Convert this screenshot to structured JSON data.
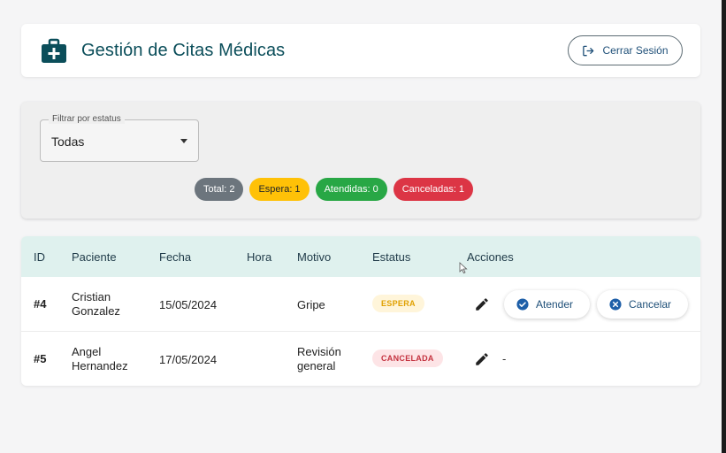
{
  "header": {
    "title": "Gestión de Citas Médicas",
    "logout_label": "Cerrar Sesión"
  },
  "filter": {
    "legend": "Filtrar por estatus",
    "value": "Todas"
  },
  "chips": {
    "total": "Total: 2",
    "espera": "Espera: 1",
    "atendidas": "Atendidas: 0",
    "canceladas": "Canceladas: 1"
  },
  "table": {
    "headers": [
      "ID",
      "Paciente",
      "Fecha",
      "Hora",
      "Motivo",
      "Estatus",
      "Acciones"
    ],
    "rows": [
      {
        "id": "#4",
        "paciente_line1": "Cristian",
        "paciente_line2": "Gonzalez",
        "fecha": "15/05/2024",
        "hora": "",
        "motivo_line1": "Gripe",
        "motivo_line2": "",
        "estatus": "ESPERA",
        "atender_label": "Atender",
        "cancelar_label": "Cancelar"
      },
      {
        "id": "#5",
        "paciente_line1": "Angel",
        "paciente_line2": "Hernandez",
        "fecha": "17/05/2024",
        "hora": "",
        "motivo_line1": "Revisión",
        "motivo_line2": "general",
        "estatus": "CANCELADA",
        "acciones_placeholder": "-"
      }
    ]
  },
  "colors": {
    "brand": "#0b4e5a",
    "header_row": "#dff1ee",
    "total": "#6c757d",
    "espera": "#ffc107",
    "atendidas": "#28a745",
    "canceladas": "#dc3545",
    "action_blue": "#1e5fa8"
  },
  "icons": {
    "brand": "medical-kit-icon",
    "logout": "logout-icon",
    "edit": "pencil-icon",
    "atender": "check-circle-icon",
    "cancelar": "x-circle-icon"
  }
}
